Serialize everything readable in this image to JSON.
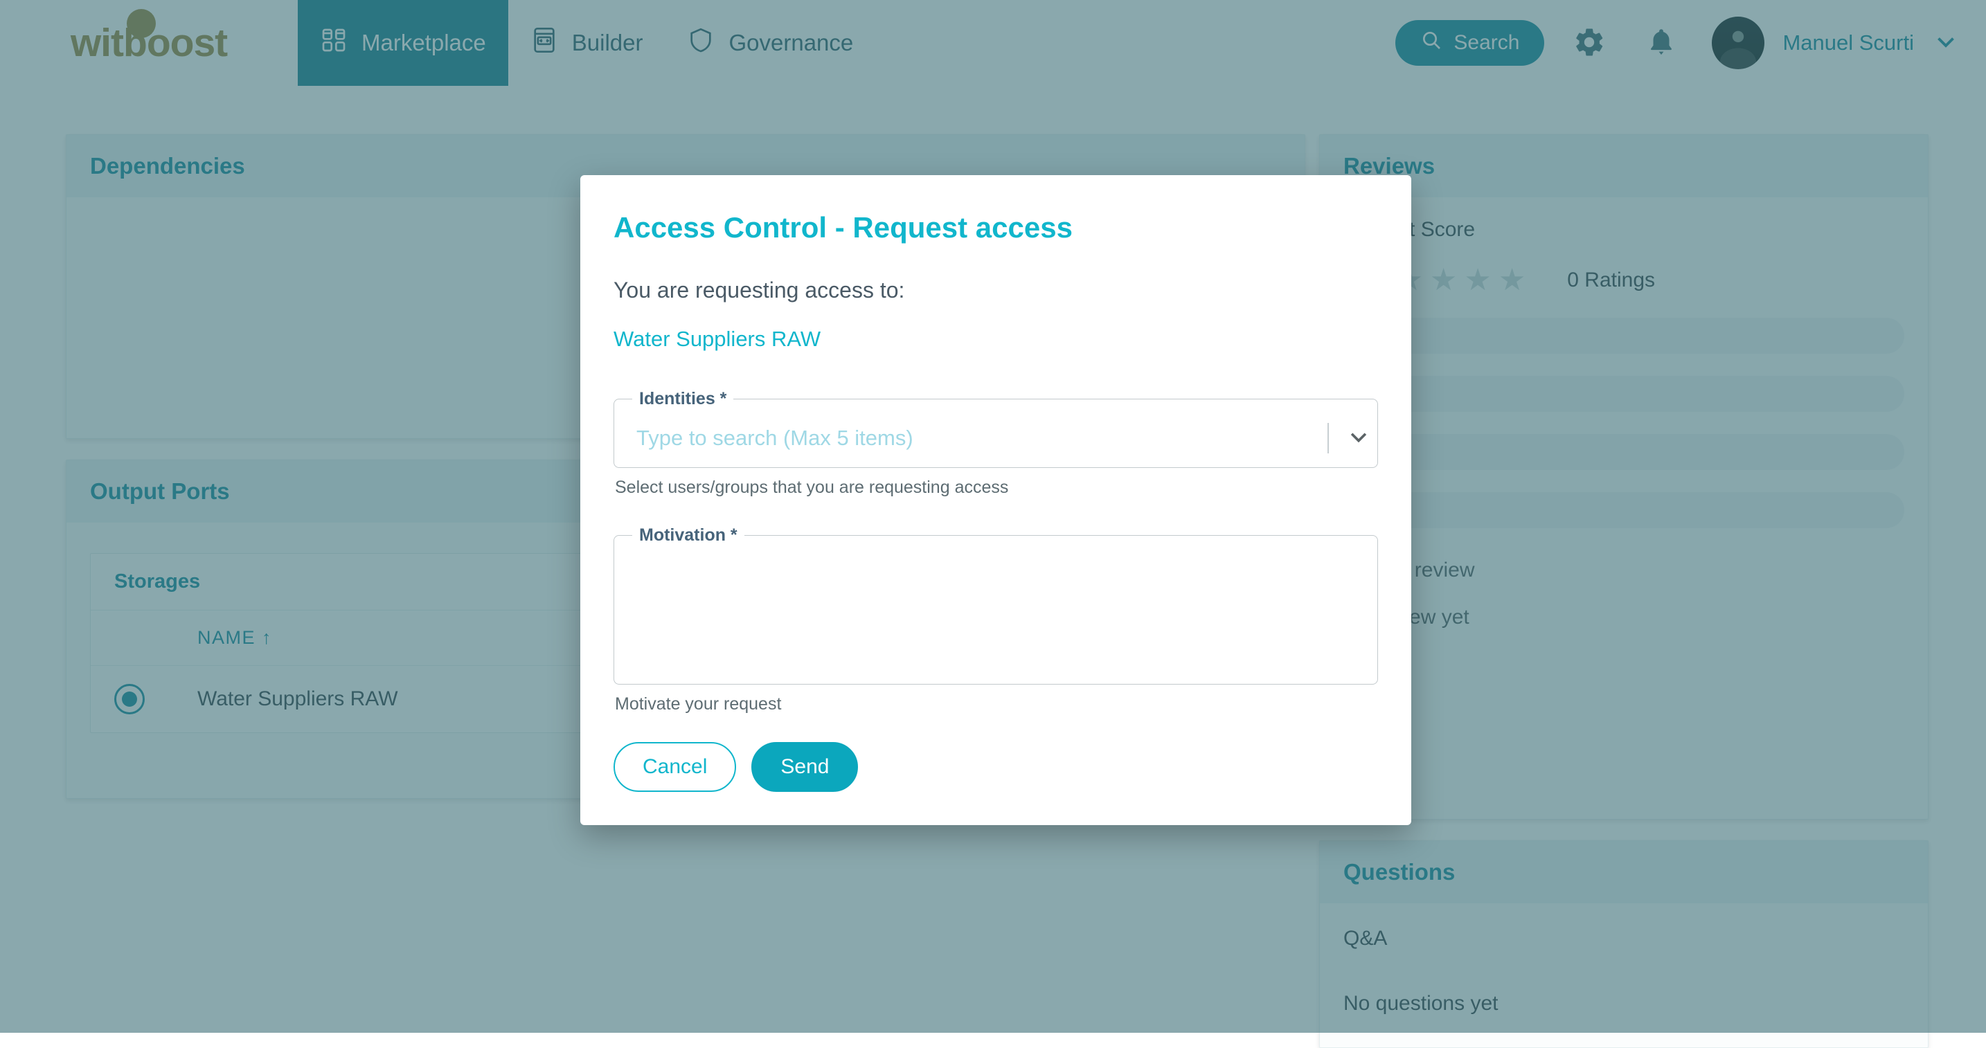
{
  "brand": {
    "logo_text": "witboost",
    "accent": "#11899d",
    "logo_color": "#9a8640"
  },
  "navbar": {
    "items": [
      {
        "label": "Marketplace",
        "icon": "grid-icon",
        "active": true
      },
      {
        "label": "Builder",
        "icon": "code-icon",
        "active": false
      },
      {
        "label": "Governance",
        "icon": "shield-icon",
        "active": false
      }
    ],
    "search_label": "Search",
    "settings_icon": "gear-icon",
    "notifications_icon": "bell-icon",
    "user_name": "Manuel Scurti",
    "user_chevron_icon": "chevron-down-icon"
  },
  "page": {
    "dependencies": {
      "title": "Dependencies",
      "empty_icon": "graph-node-icon"
    },
    "output_ports": {
      "title": "Output Ports",
      "group_title": "Storages",
      "columns": [
        "NAME ↑"
      ],
      "rows": [
        {
          "selected": true,
          "name": "Water Suppliers RAW"
        }
      ]
    },
    "reviews": {
      "title": "Reviews",
      "score_label": "Product Score",
      "stars": 5,
      "ratings_count": "0 Ratings",
      "write_review_label": "Write a review",
      "no_review_label": "No review yet"
    },
    "questions": {
      "title": "Questions",
      "qa_label": "Q&A",
      "empty_label": "No questions yet"
    }
  },
  "modal": {
    "title": "Access Control - Request access",
    "subtitle": "You are requesting access to:",
    "resource_link": "Water Suppliers RAW",
    "identities": {
      "label": "Identities *",
      "placeholder": "Type to search (Max 5 items)",
      "value": "",
      "helper": "Select users/groups that you are requesting access",
      "chevron_icon": "chevron-down-icon"
    },
    "motivation": {
      "label": "Motivation *",
      "value": "",
      "helper": "Motivate your request"
    },
    "cancel_label": "Cancel",
    "send_label": "Send"
  }
}
